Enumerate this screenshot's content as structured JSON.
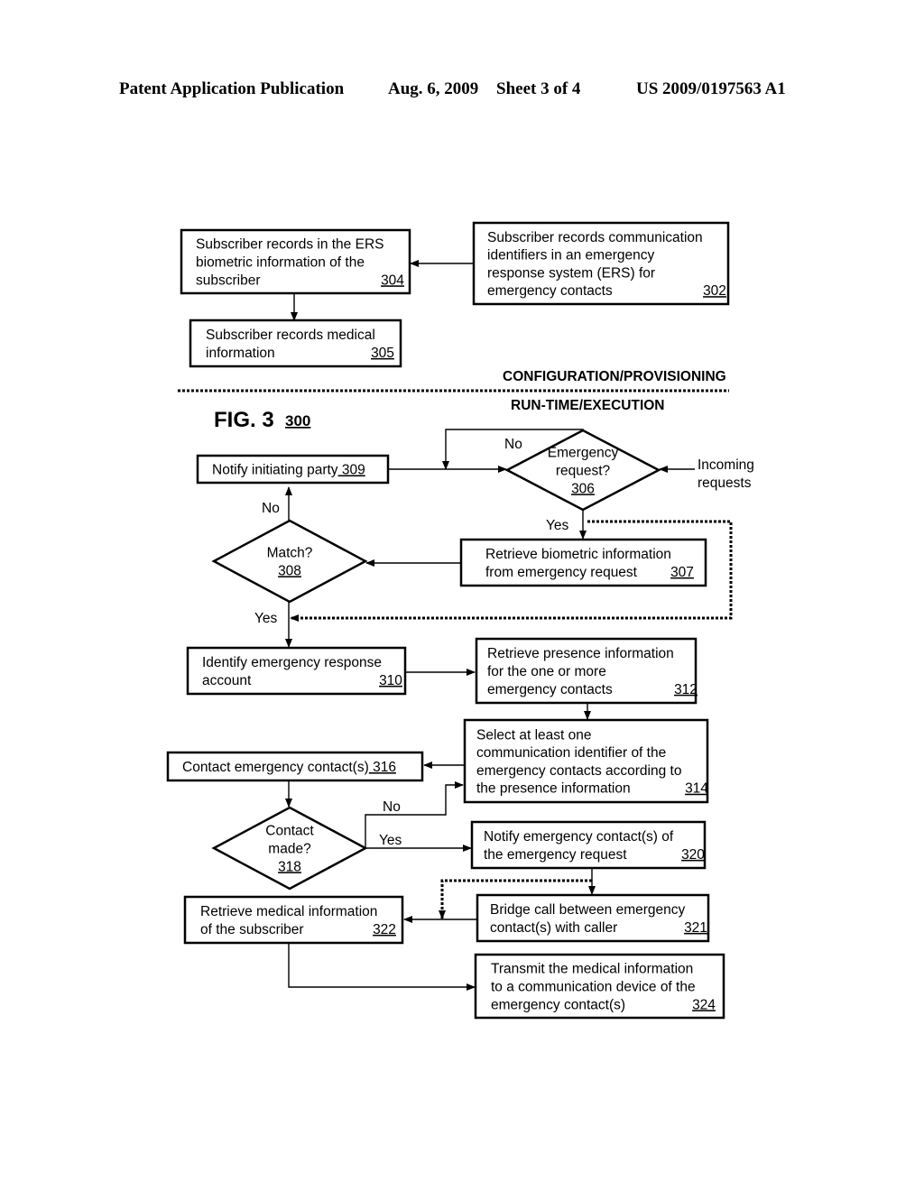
{
  "header": {
    "left": "Patent Application Publication",
    "date": "Aug. 6, 2009",
    "sheet": "Sheet 3 of 4",
    "number": "US 2009/0197563 A1"
  },
  "figure": {
    "label": "FIG. 3",
    "ref": "300",
    "section_top": "CONFIGURATION/PROVISIONING",
    "section_bottom": "RUN-TIME/EXECUTION"
  },
  "nodes": {
    "n302": {
      "lines": [
        "Subscriber records communication",
        "identifiers in an emergency",
        "response system (ERS) for",
        "emergency contacts"
      ],
      "ref": "302"
    },
    "n304": {
      "lines": [
        "Subscriber records in the ERS",
        "biometric information of the",
        "subscriber"
      ],
      "ref": "304"
    },
    "n305": {
      "lines": [
        "Subscriber records medical",
        "information"
      ],
      "ref": "305"
    },
    "n306": {
      "lines": [
        "Emergency",
        "request?"
      ],
      "ref": "306"
    },
    "n307": {
      "lines": [
        "Retrieve biometric information",
        "from emergency request"
      ],
      "ref": "307"
    },
    "n308": {
      "lines": [
        "Match?"
      ],
      "ref": "308"
    },
    "n309": {
      "lines": [
        "Notify initiating party"
      ],
      "ref": "309"
    },
    "n310": {
      "lines": [
        "Identify emergency response",
        "account"
      ],
      "ref": "310"
    },
    "n312": {
      "lines": [
        "Retrieve presence information",
        "for the one or more",
        "emergency contacts"
      ],
      "ref": "312"
    },
    "n314": {
      "lines": [
        "Select at least one",
        "communication identifier of the",
        "emergency contacts according to",
        "the presence information"
      ],
      "ref": "314"
    },
    "n316": {
      "lines": [
        "Contact emergency contact(s)"
      ],
      "ref": "316"
    },
    "n318": {
      "lines": [
        "Contact",
        "made?"
      ],
      "ref": "318"
    },
    "n320": {
      "lines": [
        "Notify emergency contact(s) of",
        "the emergency request"
      ],
      "ref": "320"
    },
    "n321": {
      "lines": [
        "Bridge call between emergency",
        "contact(s) with caller"
      ],
      "ref": "321"
    },
    "n322": {
      "lines": [
        "Retrieve medical information",
        "of the subscriber"
      ],
      "ref": "322"
    },
    "n324": {
      "lines": [
        "Transmit the medical information",
        "to a communication device of the",
        "emergency contact(s)"
      ],
      "ref": "324"
    }
  },
  "edge_labels": {
    "incoming": [
      "Incoming",
      "requests"
    ],
    "no_306": "No",
    "yes_306": "Yes",
    "no_308": "No",
    "yes_308": "Yes",
    "no_318": "No",
    "yes_318": "Yes"
  }
}
